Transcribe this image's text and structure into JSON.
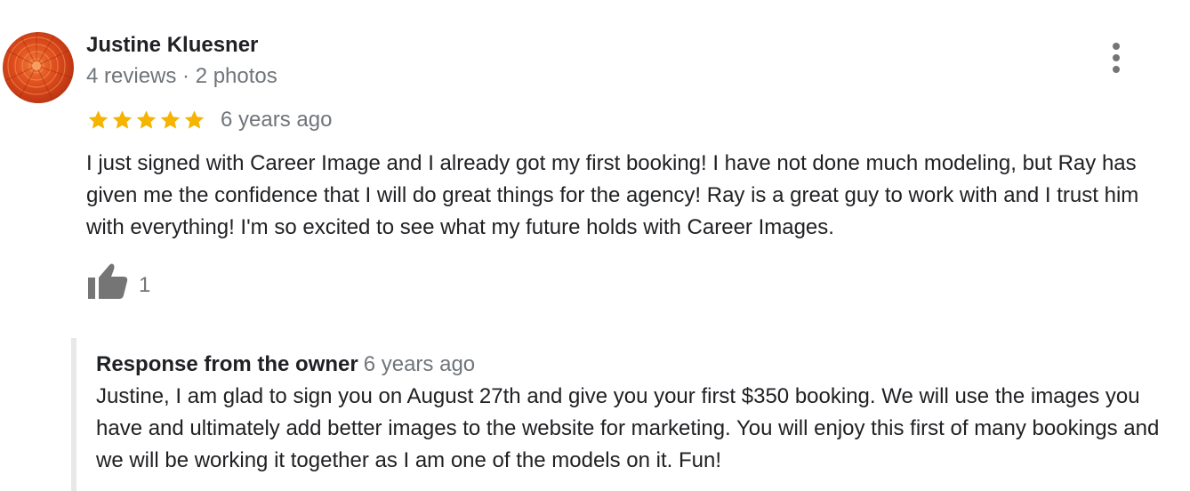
{
  "author": {
    "name": "Justine Kluesner",
    "meta": "4 reviews · 2 photos",
    "avatar_icon": "flower-avatar"
  },
  "review": {
    "rating": 5,
    "max_rating": 5,
    "date": "6 years ago",
    "text": "I just signed with Career Image and I already got my first booking! I have not done much modeling, but Ray has given me the confidence that I will do great things for the agency! Ray is a great guy to work with and I trust him with everything! I'm so excited to see what my future holds with Career Images.",
    "like_count": "1",
    "more_icon": "more-vert-icon",
    "like_icon": "thumbs-up-icon"
  },
  "owner_response": {
    "title": "Response from the owner",
    "date": "6 years ago",
    "text": "Justine, I am glad to sign you on August 27th and give you your first $350 booking. We will use the images you have and ultimately add better images to the website for marketing. You will enjoy this first of many bookings and we will be working it together as I am one of the models on it. Fun!"
  },
  "colors": {
    "star": "#f4b400",
    "secondary_text": "#70757a",
    "primary_text": "#202124",
    "icon": "#757575",
    "response_border": "#e8e8e8"
  }
}
